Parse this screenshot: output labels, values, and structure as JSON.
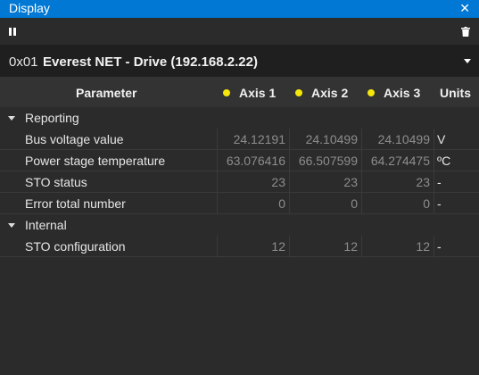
{
  "window": {
    "title": "Display",
    "close_glyph": "✕"
  },
  "toolbar": {
    "pause_icon": "pause-icon",
    "delete_icon": "trash-icon"
  },
  "drive": {
    "address": "0x01",
    "name": "Everest NET - Drive (192.168.2.22)"
  },
  "table": {
    "headers": {
      "parameter": "Parameter",
      "axis1": "Axis 1",
      "axis2": "Axis 2",
      "axis3": "Axis 3",
      "units": "Units"
    },
    "axis_dot_color": "#f5e60b",
    "groups": [
      {
        "label": "Reporting",
        "rows": [
          {
            "name": "Bus voltage value",
            "a1": "24.12191",
            "a2": "24.10499",
            "a3": "24.10499",
            "unit": "V"
          },
          {
            "name": "Power stage temperature",
            "a1": "63.076416",
            "a2": "66.507599",
            "a3": "64.274475",
            "unit": "ºC"
          },
          {
            "name": "STO status",
            "a1": "23",
            "a2": "23",
            "a3": "23",
            "unit": "-"
          },
          {
            "name": "Error total number",
            "a1": "0",
            "a2": "0",
            "a3": "0",
            "unit": "-"
          }
        ]
      },
      {
        "label": "Internal",
        "rows": [
          {
            "name": "STO configuration",
            "a1": "12",
            "a2": "12",
            "a3": "12",
            "unit": "-"
          }
        ]
      }
    ]
  }
}
